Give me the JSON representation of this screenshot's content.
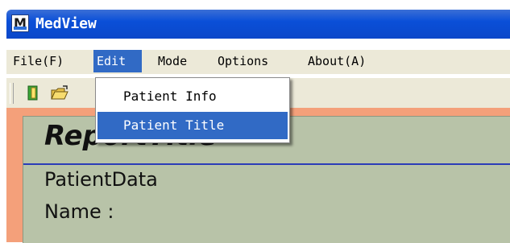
{
  "window": {
    "title": "MedView",
    "icon": "app-m-icon"
  },
  "menubar": {
    "items": [
      {
        "label": "File(F)",
        "active": false
      },
      {
        "label": "Edit",
        "active": true
      },
      {
        "label": "Mode",
        "active": false
      },
      {
        "label": "Options",
        "active": false
      },
      {
        "label": "About(A)",
        "active": false
      }
    ]
  },
  "dropdown": {
    "items": [
      {
        "label": "Patient Info",
        "highlighted": false
      },
      {
        "label": "Patient Title",
        "highlighted": true
      }
    ]
  },
  "toolbar": {
    "icons": [
      "new-document-icon",
      "open-folder-icon"
    ]
  },
  "report": {
    "title": "ReportTitle",
    "section": "PatientData",
    "name_label": "Name :"
  },
  "colors": {
    "title_bar": "#0a4fd8",
    "menu_highlight": "#316ac5",
    "client_border": "#f4a07a",
    "report_background": "#b8c3a8",
    "rule_line": "#2b3cb8"
  }
}
